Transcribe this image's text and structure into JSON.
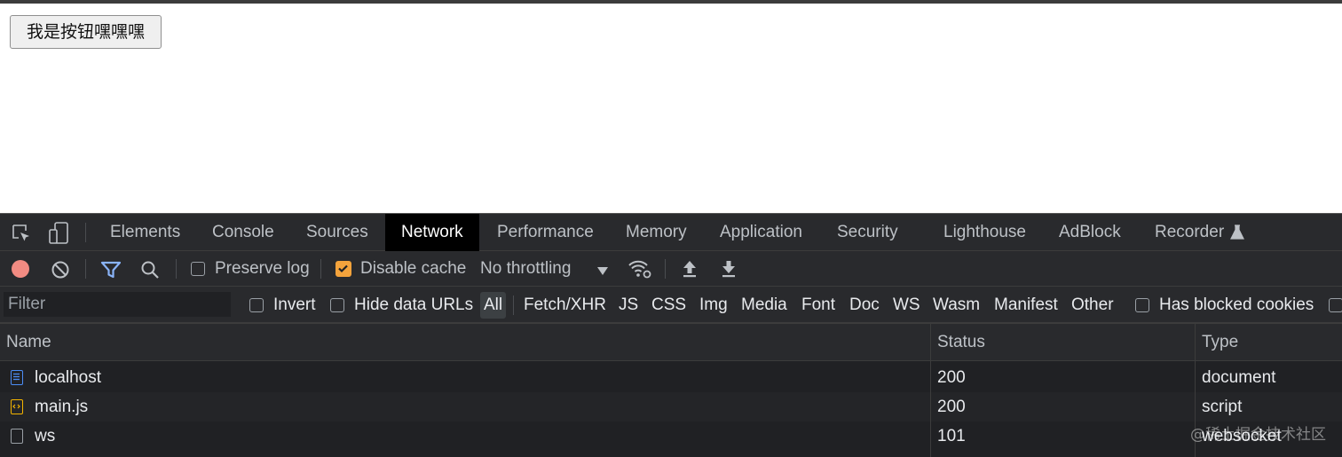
{
  "page": {
    "button_label": "我是按钮嘿嘿嘿"
  },
  "devtools": {
    "tabs": [
      {
        "label": "Elements"
      },
      {
        "label": "Console"
      },
      {
        "label": "Sources"
      },
      {
        "label": "Network"
      },
      {
        "label": "Performance"
      },
      {
        "label": "Memory"
      },
      {
        "label": "Application"
      },
      {
        "label": "Security"
      },
      {
        "label": "Lighthouse"
      },
      {
        "label": "AdBlock"
      },
      {
        "label": "Recorder"
      }
    ],
    "active_tab": "Network",
    "toolbar": {
      "preserve_log_label": "Preserve log",
      "preserve_log_checked": false,
      "disable_cache_label": "Disable cache",
      "disable_cache_checked": true,
      "throttling_value": "No throttling"
    },
    "filter": {
      "placeholder": "Filter",
      "invert_label": "Invert",
      "hide_data_urls_label": "Hide data URLs",
      "types": [
        "All",
        "Fetch/XHR",
        "JS",
        "CSS",
        "Img",
        "Media",
        "Font",
        "Doc",
        "WS",
        "Wasm",
        "Manifest",
        "Other"
      ],
      "selected_type": "All",
      "blocked_cookies_label": "Has blocked cookies"
    },
    "table": {
      "columns": [
        "Name",
        "Status",
        "Type"
      ],
      "rows": [
        {
          "name": "localhost",
          "status": "200",
          "type": "document",
          "icon": "document-icon"
        },
        {
          "name": "main.js",
          "status": "200",
          "type": "script",
          "icon": "script-icon"
        },
        {
          "name": "ws",
          "status": "101",
          "type": "websocket",
          "icon": "websocket-icon"
        }
      ]
    },
    "watermark": "@稀土掘金技术社区",
    "colors": {
      "record": "#f28b82",
      "filter_icon": "#8ab4f8",
      "checkbox_checked": "#f4a33c",
      "active_tab_bg": "#000000"
    }
  }
}
